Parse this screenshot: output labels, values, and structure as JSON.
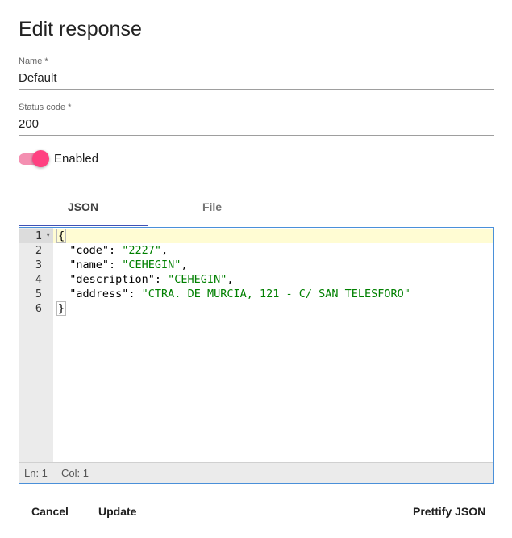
{
  "dialog": {
    "title": "Edit response"
  },
  "form": {
    "name_label": "Name *",
    "name_value": "Default",
    "status_label": "Status code *",
    "status_value": "200",
    "enabled_label": "Enabled",
    "enabled": true
  },
  "tabs": [
    {
      "label": "JSON",
      "active": true
    },
    {
      "label": "File",
      "active": false
    }
  ],
  "editor": {
    "lines": [
      {
        "num": "1",
        "parts": [
          [
            "p",
            "{"
          ]
        ]
      },
      {
        "num": "2",
        "parts": [
          [
            "p",
            "  \"code\": "
          ],
          [
            "s",
            "\"2227\""
          ],
          [
            "p",
            ","
          ]
        ]
      },
      {
        "num": "3",
        "parts": [
          [
            "p",
            "  \"name\": "
          ],
          [
            "s",
            "\"CEHEGIN\""
          ],
          [
            "p",
            ","
          ]
        ]
      },
      {
        "num": "4",
        "parts": [
          [
            "p",
            "  \"description\": "
          ],
          [
            "s",
            "\"CEHEGIN\""
          ],
          [
            "p",
            ","
          ]
        ]
      },
      {
        "num": "5",
        "parts": [
          [
            "p",
            "  \"address\": "
          ],
          [
            "s",
            "\"CTRA. DE MURCIA, 121 - C/ SAN TELESFORO\""
          ]
        ]
      },
      {
        "num": "6",
        "parts": [
          [
            "p",
            "}"
          ]
        ]
      }
    ],
    "status_line": "Ln: 1",
    "status_col": "Col: 1"
  },
  "actions": {
    "cancel": "Cancel",
    "update": "Update",
    "prettify": "Prettify JSON"
  },
  "colors": {
    "accent": "#ff4081",
    "tab_indicator": "#3f51b5",
    "string": "#008000",
    "active_line": "#fffcd3"
  }
}
